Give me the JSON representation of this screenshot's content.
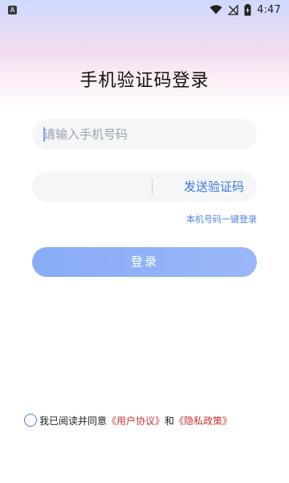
{
  "status_bar": {
    "left_badge": "A",
    "time": "4:47",
    "icons": [
      "wifi-icon",
      "no-signal-icon",
      "battery-charging-icon"
    ]
  },
  "title": "手机验证码登录",
  "phone_input": {
    "placeholder": "请输入手机号码",
    "value": ""
  },
  "code_input": {
    "placeholder": "",
    "value": ""
  },
  "send_code_label": "发送验证码",
  "one_click_login_label": "本机号码一键登录",
  "login_button_label": "登录",
  "agreement": {
    "prefix": "我已阅读并同意",
    "user_agreement": "《用户协议》",
    "and": "和",
    "privacy_policy": "《隐私政策》",
    "checked": false
  },
  "colors": {
    "accent": "#3d76e8",
    "link_red": "#d03333",
    "button": "#8fb0f8"
  }
}
